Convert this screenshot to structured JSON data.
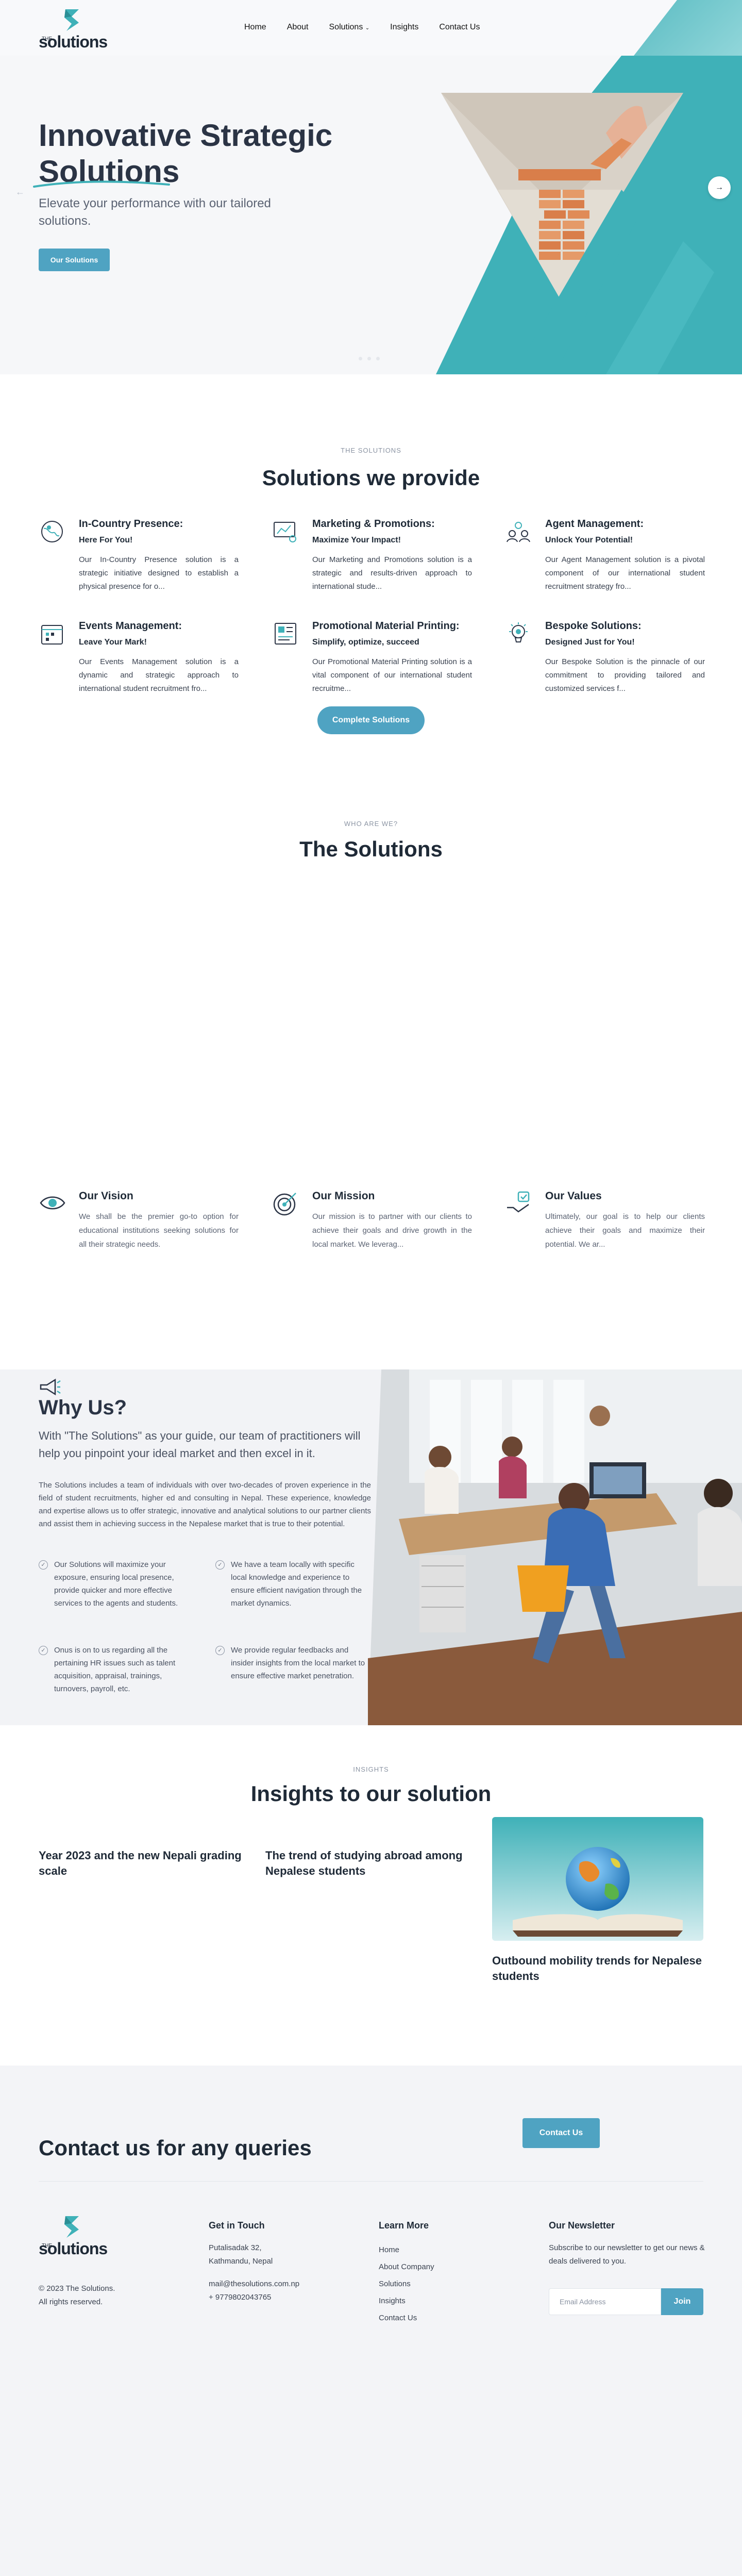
{
  "brand": {
    "the": "THE",
    "name": "solutions",
    "accent": "#4fa3c2",
    "teal": "#3fb1b8"
  },
  "nav": {
    "items": [
      "Home",
      "About",
      "Solutions",
      "Insights",
      "Contact Us"
    ]
  },
  "hero": {
    "title_line1": "Innovative Strategic",
    "title_line2": "Solutions",
    "subtitle": "Elevate your performance with our tailored solutions.",
    "cta": "Our Solutions"
  },
  "solutions": {
    "eyebrow": "THE SOLUTIONS",
    "title": "Solutions we provide",
    "items": [
      {
        "icon": "globe-icon",
        "title": "In-Country Presence:",
        "tagline": "Here For You!",
        "text": "Our In-Country Presence solution is a strategic initiative designed to establish a physical presence for o..."
      },
      {
        "icon": "marketing-icon",
        "title": "Marketing & Promotions:",
        "tagline": "Maximize Your Impact!",
        "text": "Our Marketing and Promotions solution is a strategic and results-driven approach to international stude..."
      },
      {
        "icon": "agents-icon",
        "title": "Agent Management:",
        "tagline": "Unlock Your Potential!",
        "text": "Our Agent Management solution is a pivotal component of our international student recruitment strategy fro..."
      },
      {
        "icon": "calendar-icon",
        "title": "Events Management:",
        "tagline": "Leave Your Mark!",
        "text": "Our Events Management solution is a dynamic and strategic approach to international student recruitment fro..."
      },
      {
        "icon": "brochure-icon",
        "title": "Promotional Material Printing:",
        "tagline": "Simplify, optimize, succeed",
        "text": "Our Promotional Material Printing solution is a vital component of our international student recruitme..."
      },
      {
        "icon": "idea-icon",
        "title": "Bespoke Solutions:",
        "tagline": "Designed Just for You!",
        "text": "Our Bespoke Solution is the pinnacle of our commitment to providing tailored and customized services f..."
      }
    ],
    "cta": "Complete Solutions"
  },
  "who": {
    "eyebrow": "WHO ARE WE?",
    "title": "The Solutions",
    "items": [
      {
        "icon": "eye-icon",
        "title": "Our Vision",
        "text": "We shall be the premier go-to option for educational institutions seeking solutions for all their strategic needs."
      },
      {
        "icon": "target-icon",
        "title": "Our Mission",
        "text": "Our mission is to partner with our clients to achieve their goals and drive growth in the local market. We leverag..."
      },
      {
        "icon": "values-icon",
        "title": "Our Values",
        "text": "Ultimately, our goal is to help our clients achieve their goals and maximize their potential. We ar..."
      }
    ]
  },
  "why": {
    "title": "Why Us?",
    "lead": "With \"The Solutions\" as your guide, our team of practitioners will help you pinpoint your ideal market and then excel in it.",
    "body": "The Solutions includes a team of individuals with over two-decades of proven experience in the field of student recruitments, higher ed and consulting in Nepal. These experience, knowledge and expertise allows us to offer strategic, innovative and analytical solutions to our partner clients and assist them in achieving success in the Nepalese market that is true to their potential.",
    "points": [
      "Our Solutions will maximize your exposure, ensuring local presence, provide quicker and more effective services to the agents and students.",
      "We have a team locally with specific local knowledge and experience to ensure efficient navigation through the market dynamics.",
      "Onus is on to us regarding all the pertaining HR issues such as talent acquisition, appraisal, trainings, turnovers, payroll, etc.",
      "We provide regular feedbacks and insider insights from the local market to ensure effective market penetration."
    ]
  },
  "insights": {
    "eyebrow": "INSIGHTS",
    "title": "Insights to our solution",
    "items": [
      "Year 2023 and the new Nepali grading scale",
      "The trend of studying abroad among Nepalese students",
      "Outbound mobility trends for Nepalese students"
    ]
  },
  "contact": {
    "title": "Contact us for any queries",
    "cta": "Contact Us"
  },
  "footer": {
    "copyright_line1": "© 2023 The Solutions.",
    "copyright_line2": "All rights reserved.",
    "touch_title": "Get in Touch",
    "address1": "Putalisadak 32,",
    "address2": "Kathmandu, Nepal",
    "email": "mail@thesolutions.com.np",
    "phone": "+ 9779802043765",
    "learn_title": "Learn More",
    "links": [
      "Home",
      "About Company",
      "Solutions",
      "Insights",
      "Contact Us"
    ],
    "news_title": "Our Newsletter",
    "news_text": "Subscribe to our newsletter to get our news & deals delivered to you.",
    "news_placeholder": "Email Address",
    "news_button": "Join"
  }
}
